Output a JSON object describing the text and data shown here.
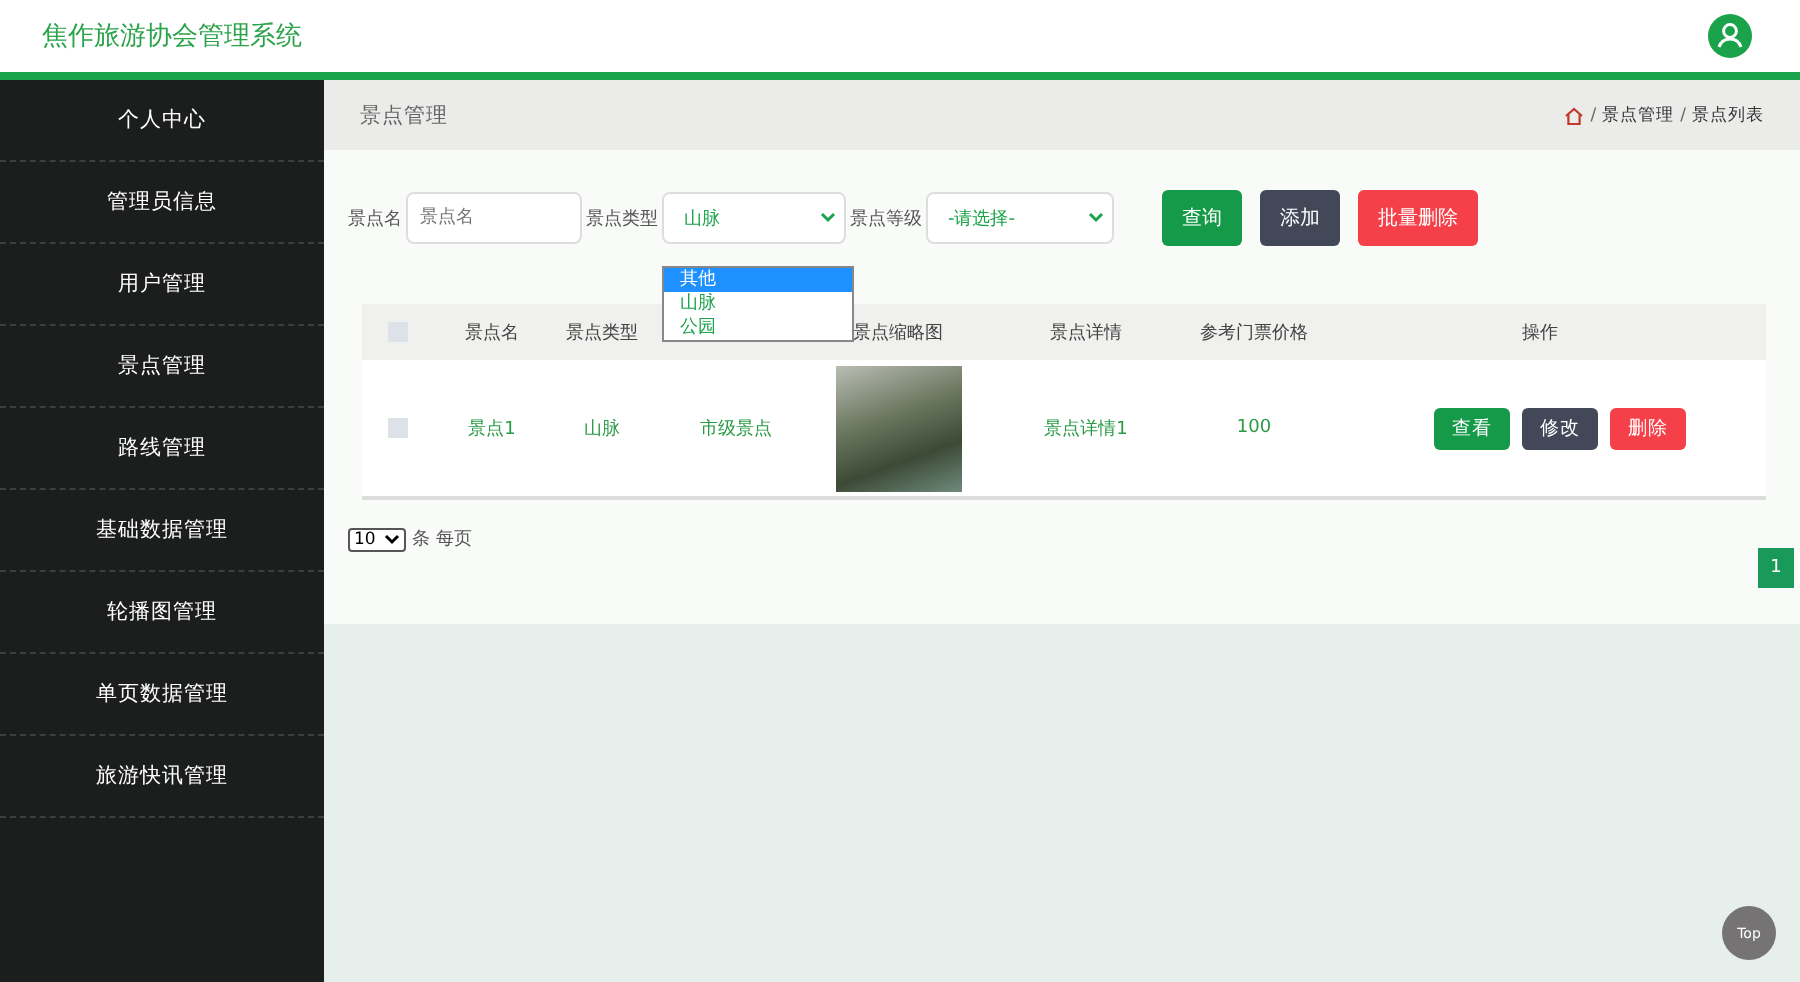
{
  "app_title": "焦作旅游协会管理系统",
  "sidebar": {
    "items": [
      {
        "label": "个人中心"
      },
      {
        "label": "管理员信息"
      },
      {
        "label": "用户管理"
      },
      {
        "label": "景点管理"
      },
      {
        "label": "路线管理"
      },
      {
        "label": "基础数据管理"
      },
      {
        "label": "轮播图管理"
      },
      {
        "label": "单页数据管理"
      },
      {
        "label": "旅游快讯管理"
      }
    ]
  },
  "page_header": {
    "title": "景点管理",
    "breadcrumb": [
      "景点管理",
      "景点列表"
    ],
    "separator": "/"
  },
  "filters": {
    "name": {
      "label": "景点名",
      "placeholder": "景点名"
    },
    "type": {
      "label": "景点类型",
      "value": "山脉",
      "open": true,
      "options": [
        {
          "label": "其他",
          "highlighted": true
        },
        {
          "label": "山脉",
          "highlighted": false
        },
        {
          "label": "公园",
          "highlighted": false
        }
      ]
    },
    "level": {
      "label": "景点等级",
      "value": "-请选择-"
    },
    "buttons": [
      {
        "label": "查询",
        "kind": "search"
      },
      {
        "label": "添加",
        "kind": "add"
      },
      {
        "label": "批量删除",
        "kind": "delete"
      }
    ]
  },
  "table": {
    "select_all_checked": false,
    "columns": [
      "景点名",
      "景点类型",
      null,
      "景点缩略图",
      "景点详情",
      "参考门票价格",
      "操作"
    ],
    "rows": [
      {
        "checked": false,
        "name": "景点1",
        "type": "山脉",
        "level": "市级景点",
        "detail": "景点详情1",
        "price": "100",
        "actions": [
          {
            "label": "查看",
            "kind": "view"
          },
          {
            "label": "修改",
            "kind": "edit"
          },
          {
            "label": "删除",
            "kind": "delete"
          }
        ]
      }
    ]
  },
  "pagination": {
    "page_size": "10",
    "page_size_label": "条 每页",
    "pages": [
      {
        "label": "1",
        "selected": true
      }
    ]
  },
  "top_button": "Top"
}
